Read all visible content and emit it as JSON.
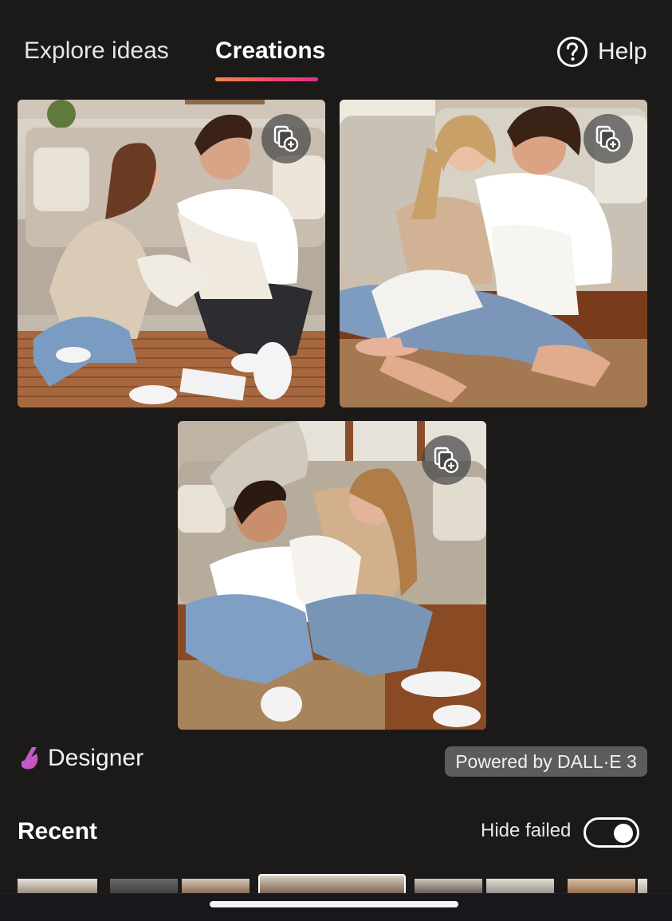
{
  "tabs": {
    "explore": "Explore ideas",
    "creations": "Creations",
    "active": "creations"
  },
  "help": {
    "label": "Help",
    "icon": "question-circle-icon"
  },
  "images": [
    {
      "name": "couple-pillow-fight-1",
      "action_icon": "copy-add-icon"
    },
    {
      "name": "couple-pillow-fight-2",
      "action_icon": "copy-add-icon"
    },
    {
      "name": "couple-pillow-fight-3",
      "action_icon": "copy-add-icon"
    }
  ],
  "brand": {
    "label": "Designer",
    "icon": "designer-logo-icon"
  },
  "powered_by": "Powered by DALL·E 3",
  "recent": {
    "title": "Recent",
    "hide_failed_label": "Hide failed",
    "hide_failed_on": true,
    "thumbnail_count": 8,
    "selected_index": 3
  },
  "colors": {
    "background": "#1b1a19",
    "tab_underline_start": "#f38a4a",
    "tab_underline_end": "#d9328f",
    "badge_bg": "#5c5c5c",
    "brand_gradient_start": "#a86bf0",
    "brand_gradient_end": "#e0479e"
  }
}
